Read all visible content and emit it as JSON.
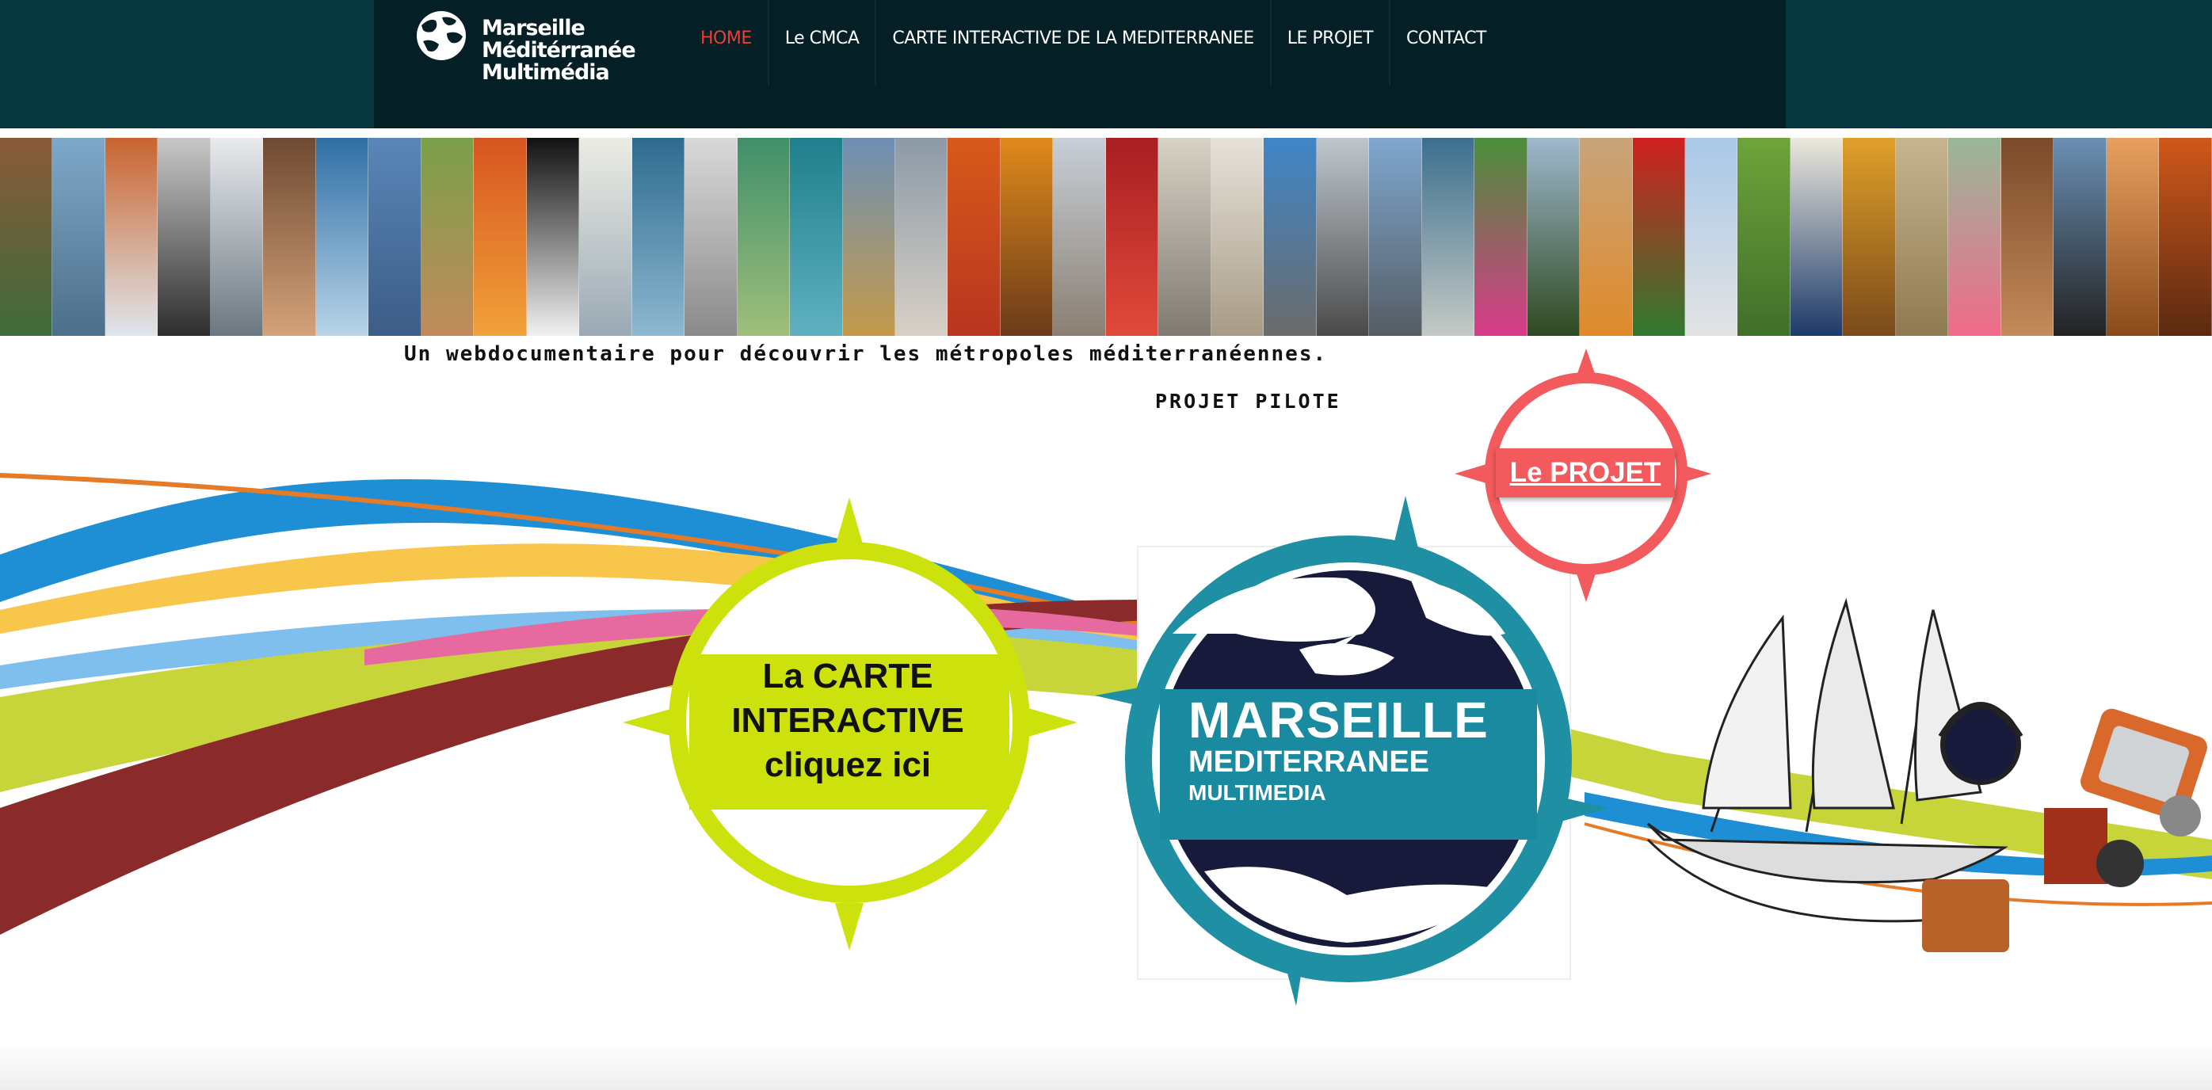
{
  "header": {
    "logo_lines": [
      "Marseille",
      "Méditérranée",
      "Multimédia"
    ],
    "menu": [
      {
        "label": "HOME",
        "active": true
      },
      {
        "label": "Le CMCA",
        "active": false
      },
      {
        "label": "CARTE INTERACTIVE DE LA MEDITERRANEE",
        "active": false
      },
      {
        "label": "LE PROJET",
        "active": false
      },
      {
        "label": "CONTACT",
        "active": false
      }
    ]
  },
  "photo_strip": {
    "tiles": [
      {
        "note": "",
        "colors": [
          "#8a5a3a",
          "#3e6b3a"
        ]
      },
      {
        "note": "",
        "colors": [
          "#7fa8c9",
          "#4c6f8a"
        ]
      },
      {
        "note": "",
        "colors": [
          "#c9642f",
          "#dfe6ec"
        ]
      },
      {
        "note": "",
        "colors": [
          "#c8c8c8",
          "#2d2d2d"
        ]
      },
      {
        "note": "",
        "colors": [
          "#e8ebee",
          "#6b7780"
        ]
      },
      {
        "note": "",
        "colors": [
          "#6e4a32",
          "#d4a27a"
        ]
      },
      {
        "note": "",
        "colors": [
          "#2f6fa5",
          "#b8d4e8"
        ]
      },
      {
        "note": "",
        "colors": [
          "#5a86b8",
          "#3c5d86"
        ]
      },
      {
        "note": "",
        "colors": [
          "#7aa04a",
          "#c28a5b"
        ]
      },
      {
        "note": "",
        "colors": [
          "#d6541f",
          "#f2a23a"
        ]
      },
      {
        "note": "",
        "colors": [
          "#111111",
          "#f1f1f1"
        ]
      },
      {
        "note": "",
        "colors": [
          "#ecece4",
          "#9aa9b5"
        ]
      },
      {
        "note": "",
        "colors": [
          "#2f6b8f",
          "#8db8d0"
        ]
      },
      {
        "note": "",
        "colors": [
          "#d9d9d9",
          "#8a8a8a"
        ]
      },
      {
        "note": "",
        "colors": [
          "#3f8f6a",
          "#9fbf7a"
        ]
      },
      {
        "note": "",
        "colors": [
          "#1f7f8c",
          "#5fb1c0"
        ]
      },
      {
        "note": "",
        "colors": [
          "#6d8fb5",
          "#c49a4a"
        ]
      },
      {
        "note": "",
        "colors": [
          "#8c9aa8",
          "#d8d0c6"
        ]
      },
      {
        "note": "",
        "colors": [
          "#d85a1a",
          "#b8351f"
        ]
      },
      {
        "note": "",
        "colors": [
          "#e08a1a",
          "#6a3a1a"
        ]
      },
      {
        "note": "",
        "colors": [
          "#c8cfd8",
          "#8a7f72"
        ]
      },
      {
        "note": "",
        "colors": [
          "#a81e22",
          "#e14a3a"
        ]
      },
      {
        "note": "",
        "colors": [
          "#d8d2c6",
          "#7f7a70"
        ]
      },
      {
        "note": "",
        "colors": [
          "#e6e2da",
          "#a89b86"
        ]
      },
      {
        "note": "",
        "colors": [
          "#3f86c8",
          "#6b6b6b"
        ]
      },
      {
        "note": "",
        "colors": [
          "#bfc6cc",
          "#4a4a4a"
        ]
      },
      {
        "note": "",
        "colors": [
          "#7fa7d0",
          "#555c63"
        ]
      },
      {
        "note": "",
        "colors": [
          "#3b6f8f",
          "#c5c9c4"
        ]
      },
      {
        "note": "",
        "colors": [
          "#4a8f3a",
          "#d83a8a"
        ]
      },
      {
        "note": "",
        "colors": [
          "#9fb8cc",
          "#2f4a20"
        ]
      },
      {
        "note": "",
        "colors": [
          "#c8a47a",
          "#e08a2a"
        ]
      },
      {
        "note": "",
        "colors": [
          "#d02020",
          "#2f7a2f"
        ]
      },
      {
        "note": "",
        "colors": [
          "#a8c8e8",
          "#e3e3e3"
        ]
      },
      {
        "note": "",
        "colors": [
          "#6ea43a",
          "#3f6f2a"
        ]
      },
      {
        "note": "",
        "colors": [
          "#ece8dc",
          "#1d3a6a"
        ]
      },
      {
        "note": "",
        "colors": [
          "#e0a02a",
          "#7a4a1a"
        ]
      },
      {
        "note": "",
        "colors": [
          "#c6b58f",
          "#8f7a52"
        ]
      },
      {
        "note": "",
        "colors": [
          "#98b89a",
          "#f06a8a"
        ]
      },
      {
        "note": "",
        "colors": [
          "#7a4a2a",
          "#c48a5a"
        ]
      },
      {
        "note": "",
        "colors": [
          "#6a8fb5",
          "#222222"
        ]
      },
      {
        "note": "",
        "colors": [
          "#e8a060",
          "#8a4a1a"
        ]
      },
      {
        "note": "",
        "colors": [
          "#d0581a",
          "#5a2a10"
        ]
      }
    ]
  },
  "tagline": "Un webdocumentaire pour découvrir les métropoles méditerranéennes.",
  "pilot_label": "PROJET PILOTE",
  "buttons": {
    "projet": "Le PROJET",
    "carte_lines": [
      "La CARTE",
      "INTERACTIVE",
      "cliquez ici"
    ],
    "mmm_lines": [
      "MARSEILLE",
      "MEDITERRANEE",
      "MULTIMEDIA"
    ]
  },
  "colors": {
    "header_bg": "#06373e",
    "header_inner": "#041f25",
    "menu_active": "#ef3d32",
    "projet_red": "#f25a5d",
    "carte_yellow": "#cde20c",
    "mmm_teal": "#1f8fa3",
    "mmm_navy": "#171a3a"
  }
}
